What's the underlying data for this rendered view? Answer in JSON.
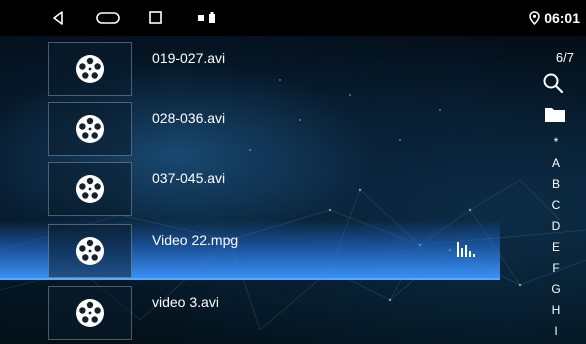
{
  "status_bar": {
    "time": "06:01",
    "icons": [
      "back-icon",
      "home-icon",
      "recent-apps-icon",
      "sd-card-icon",
      "battery-icon",
      "location-icon"
    ]
  },
  "file_list": {
    "items": [
      {
        "name": "019-027.avi",
        "selected": false
      },
      {
        "name": "028-036.avi",
        "selected": false
      },
      {
        "name": "037-045.avi",
        "selected": false
      },
      {
        "name": "Video 22.mpg",
        "selected": true
      },
      {
        "name": "video 3.avi",
        "selected": false
      }
    ],
    "thumbnail_icon": "film-reel-icon",
    "playing_indicator_icon": "equalizer-icon"
  },
  "sidebar": {
    "page_indicator": "6/7",
    "search_icon": "search-icon",
    "folder_icon": "folder-icon",
    "index_letters": [
      "*",
      "A",
      "B",
      "C",
      "D",
      "E",
      "F",
      "G",
      "H",
      "I"
    ]
  },
  "colors": {
    "selected_highlight": "#3c96ff",
    "status_bar_bg": "#000000",
    "text": "#ffffff"
  }
}
